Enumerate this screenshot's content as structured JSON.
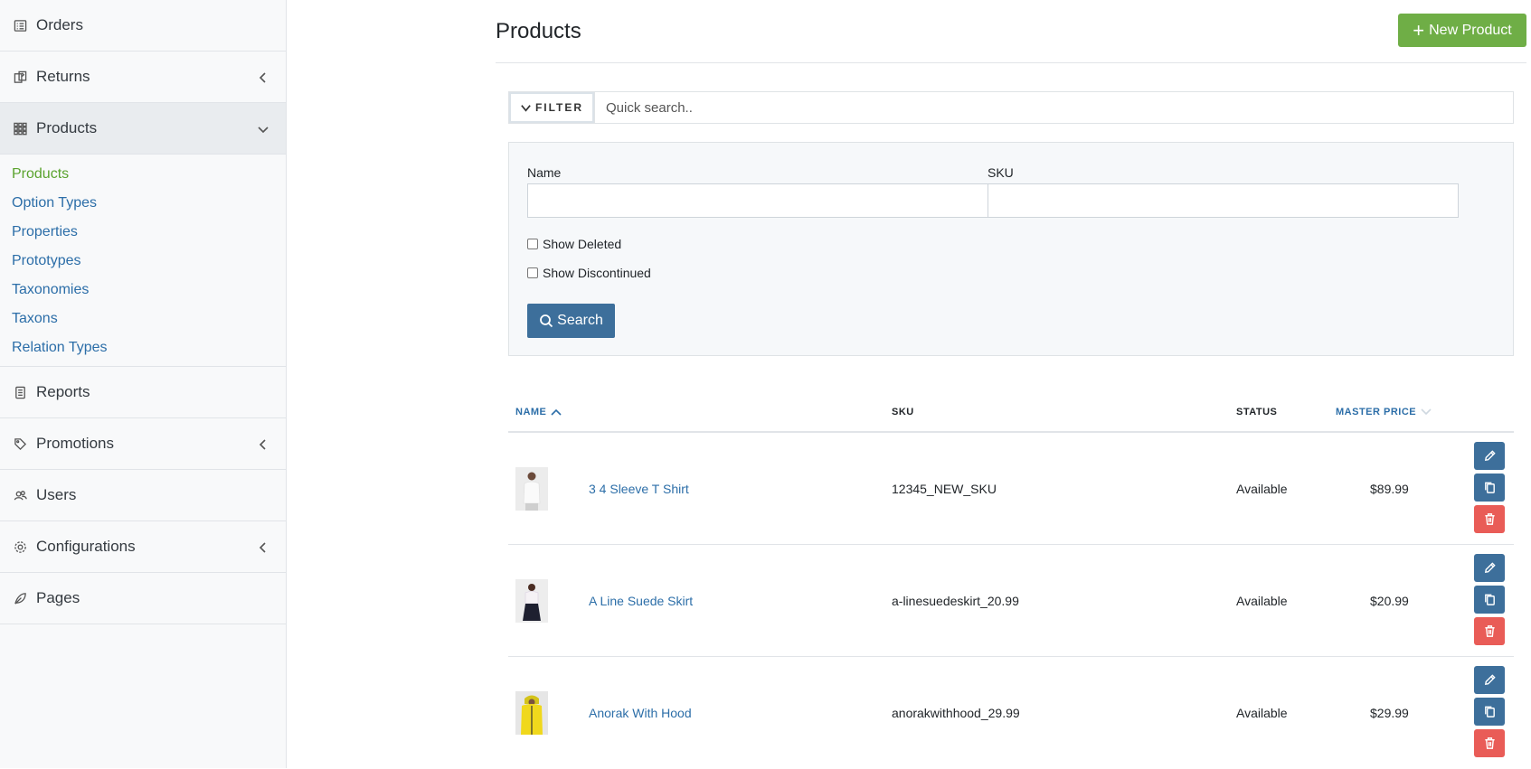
{
  "sidebar": {
    "items": [
      {
        "label": "Orders",
        "icon": "orders-icon"
      },
      {
        "label": "Returns",
        "icon": "returns-icon"
      },
      {
        "label": "Products",
        "icon": "products-icon"
      },
      {
        "label": "Reports",
        "icon": "reports-icon"
      },
      {
        "label": "Promotions",
        "icon": "promotions-icon"
      },
      {
        "label": "Users",
        "icon": "users-icon"
      },
      {
        "label": "Configurations",
        "icon": "configurations-icon"
      },
      {
        "label": "Pages",
        "icon": "pages-icon"
      }
    ],
    "products_sub": [
      "Products",
      "Option Types",
      "Properties",
      "Prototypes",
      "Taxonomies",
      "Taxons",
      "Relation Types"
    ]
  },
  "header": {
    "title": "Products",
    "new_button": "New Product"
  },
  "filter": {
    "toggle_label": "FILTER",
    "quick_search_placeholder": "Quick search..",
    "name_label": "Name",
    "sku_label": "SKU",
    "show_deleted": "Show Deleted",
    "show_discontinued": "Show Discontinued",
    "search_button": "Search"
  },
  "table": {
    "headers": {
      "name": "NAME",
      "sku": "SKU",
      "status": "STATUS",
      "price": "MASTER PRICE"
    },
    "rows": [
      {
        "name": "3 4 Sleeve T Shirt",
        "sku": "12345_NEW_SKU",
        "status": "Available",
        "price": "$89.99"
      },
      {
        "name": "A Line Suede Skirt",
        "sku": "a-linesuedeskirt_20.99",
        "status": "Available",
        "price": "$20.99"
      },
      {
        "name": "Anorak With Hood",
        "sku": "anorakwithhood_29.99",
        "status": "Available",
        "price": "$29.99"
      }
    ]
  },
  "colors": {
    "accent_green": "#6fae46",
    "link_blue": "#2c6ea8",
    "button_blue": "#3d6f9b",
    "danger_red": "#e95c57"
  }
}
